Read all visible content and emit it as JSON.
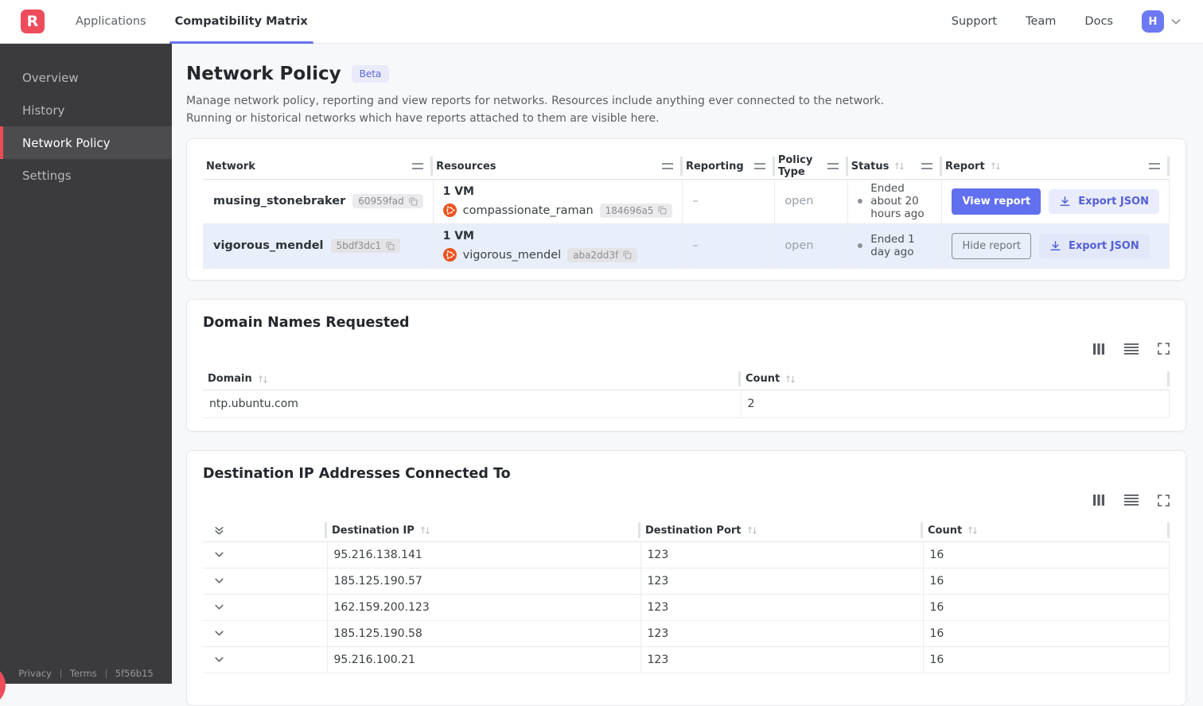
{
  "navbar": {
    "logo_letter": "R",
    "tabs": [
      {
        "label": "Applications"
      },
      {
        "label": "Compatibility Matrix"
      }
    ],
    "links": [
      {
        "label": "Support"
      },
      {
        "label": "Team"
      },
      {
        "label": "Docs"
      }
    ],
    "avatar_initial": "H"
  },
  "sidebar": {
    "items": [
      {
        "label": "Overview"
      },
      {
        "label": "History"
      },
      {
        "label": "Network Policy"
      },
      {
        "label": "Settings"
      }
    ],
    "footer": {
      "privacy": "Privacy",
      "terms": "Terms",
      "build": "5f56b15"
    }
  },
  "page": {
    "title": "Network Policy",
    "beta_badge": "Beta",
    "description": "Manage network policy, reporting and view reports for networks. Resources include anything ever connected to the network. Running or historical networks which have reports attached to them are visible here."
  },
  "networks_table": {
    "columns": [
      {
        "label": "Network"
      },
      {
        "label": "Resources"
      },
      {
        "label": "Reporting"
      },
      {
        "label": "Policy Type"
      },
      {
        "label": "Status"
      },
      {
        "label": "Report"
      }
    ],
    "rows": [
      {
        "name": "musing_stonebraker",
        "id": "60959fad",
        "vm_summary": "1 VM",
        "resource_name": "compassionate_raman",
        "resource_id": "184696a5",
        "reporting": "–",
        "policy_type": "open",
        "status": "Ended about 20 hours ago",
        "report_button": "View report",
        "export_button": "Export JSON"
      },
      {
        "name": "vigorous_mendel",
        "id": "5bdf3dc1",
        "vm_summary": "1 VM",
        "resource_name": "vigorous_mendel",
        "resource_id": "aba2dd3f",
        "reporting": "–",
        "policy_type": "open",
        "status": "Ended 1 day ago",
        "report_button": "Hide report",
        "export_button": "Export JSON"
      }
    ]
  },
  "domain_table": {
    "title": "Domain Names Requested",
    "columns": [
      {
        "label": "Domain"
      },
      {
        "label": "Count"
      }
    ],
    "rows": [
      {
        "domain": "ntp.ubuntu.com",
        "count": "2"
      }
    ]
  },
  "destination_table": {
    "title": "Destination IP Addresses Connected To",
    "columns": [
      {
        "label": "Destination IP"
      },
      {
        "label": "Destination Port"
      },
      {
        "label": "Count"
      }
    ],
    "rows": [
      {
        "ip": "95.216.138.141",
        "port": "123",
        "count": "16"
      },
      {
        "ip": "185.125.190.57",
        "port": "123",
        "count": "16"
      },
      {
        "ip": "162.159.200.123",
        "port": "123",
        "count": "16"
      },
      {
        "ip": "185.125.190.58",
        "port": "123",
        "count": "16"
      },
      {
        "ip": "95.216.100.21",
        "port": "123",
        "count": "16"
      }
    ]
  },
  "colors": {
    "accent": "#6673f0",
    "brand_red": "#ee4c5b",
    "row_highlight": "#e9eefb",
    "ubuntu_orange": "#e95420"
  }
}
